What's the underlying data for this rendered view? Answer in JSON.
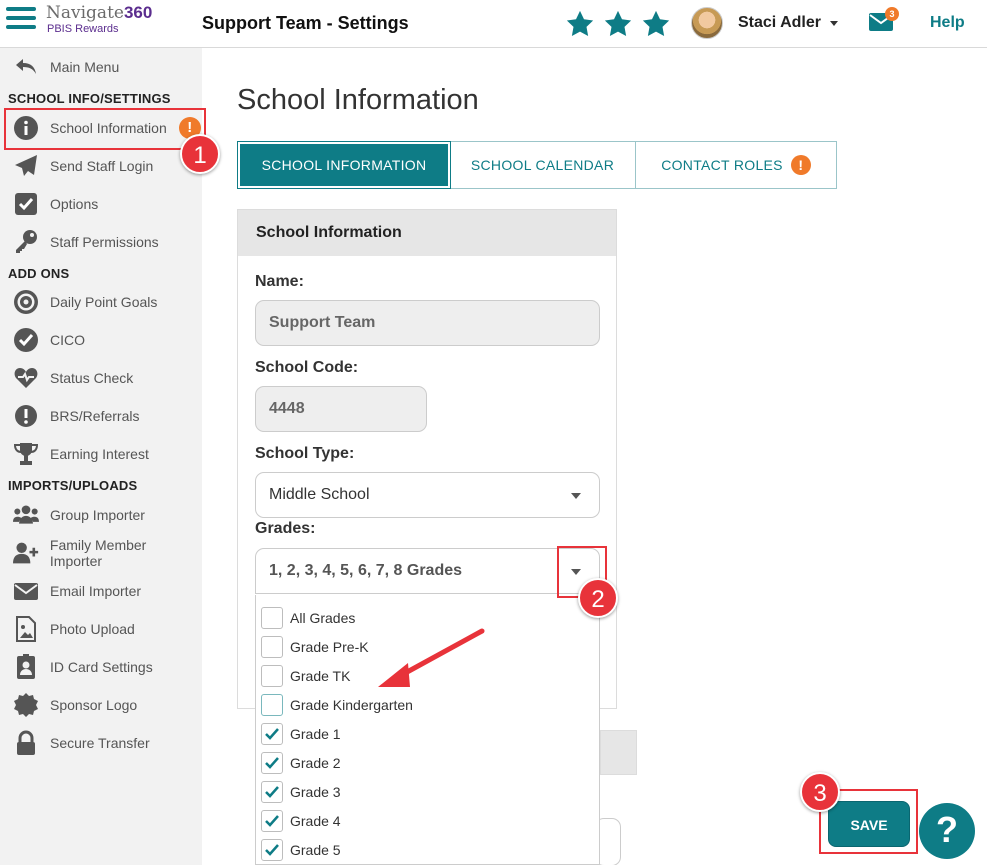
{
  "app": {
    "brand_name": "Navigate",
    "brand_number": "360",
    "brand_sub": "PBIS Rewards",
    "page_title": "Support Team - Settings",
    "user_name": "Staci Adler",
    "mail_count": "3",
    "help_label": "Help",
    "accent_color": "#0e7c86",
    "alert_color": "#f07a2a"
  },
  "sidebar": {
    "main_menu": "Main Menu",
    "sections": {
      "school": "SCHOOL INFO/SETTINGS",
      "addons": "ADD ONS",
      "imports": "IMPORTS/UPLOADS"
    },
    "items": {
      "school_information": "School Information",
      "send_staff_login": "Send Staff Login",
      "options": "Options",
      "staff_permissions": "Staff Permissions",
      "daily_point_goals": "Daily Point Goals",
      "cico": "CICO",
      "status_check": "Status Check",
      "brs_referrals": "BRS/Referrals",
      "earning_interest": "Earning Interest",
      "group_importer": "Group Importer",
      "family_member_importer": "Family Member Importer",
      "email_importer": "Email Importer",
      "photo_upload": "Photo Upload",
      "id_card_settings": "ID Card Settings",
      "sponsor_logo": "Sponsor Logo",
      "secure_transfer": "Secure Transfer"
    },
    "alert_mark": "!"
  },
  "main": {
    "heading": "School Information",
    "tabs": {
      "school_information": "SCHOOL INFORMATION",
      "school_calendar": "SCHOOL CALENDAR",
      "contact_roles": "CONTACT ROLES"
    },
    "card_title": "School Information",
    "name_label": "Name:",
    "name_value": "Support Team",
    "code_label": "School Code:",
    "code_value": "4448",
    "type_label": "School Type:",
    "type_value": "Middle School",
    "grades_label": "Grades:",
    "grades_value": "1, 2, 3, 4, 5, 6, 7, 8 Grades",
    "grade_options": {
      "all": "All Grades",
      "prek": "Grade Pre-K",
      "tk": "Grade TK",
      "k": "Grade Kindergarten",
      "g1": "Grade 1",
      "g2": "Grade 2",
      "g3": "Grade 3",
      "g4": "Grade 4",
      "g5": "Grade 5"
    },
    "save_label": "SAVE",
    "help_fab": "?"
  },
  "annotations": {
    "m1": "1",
    "m2": "2",
    "m3": "3"
  }
}
